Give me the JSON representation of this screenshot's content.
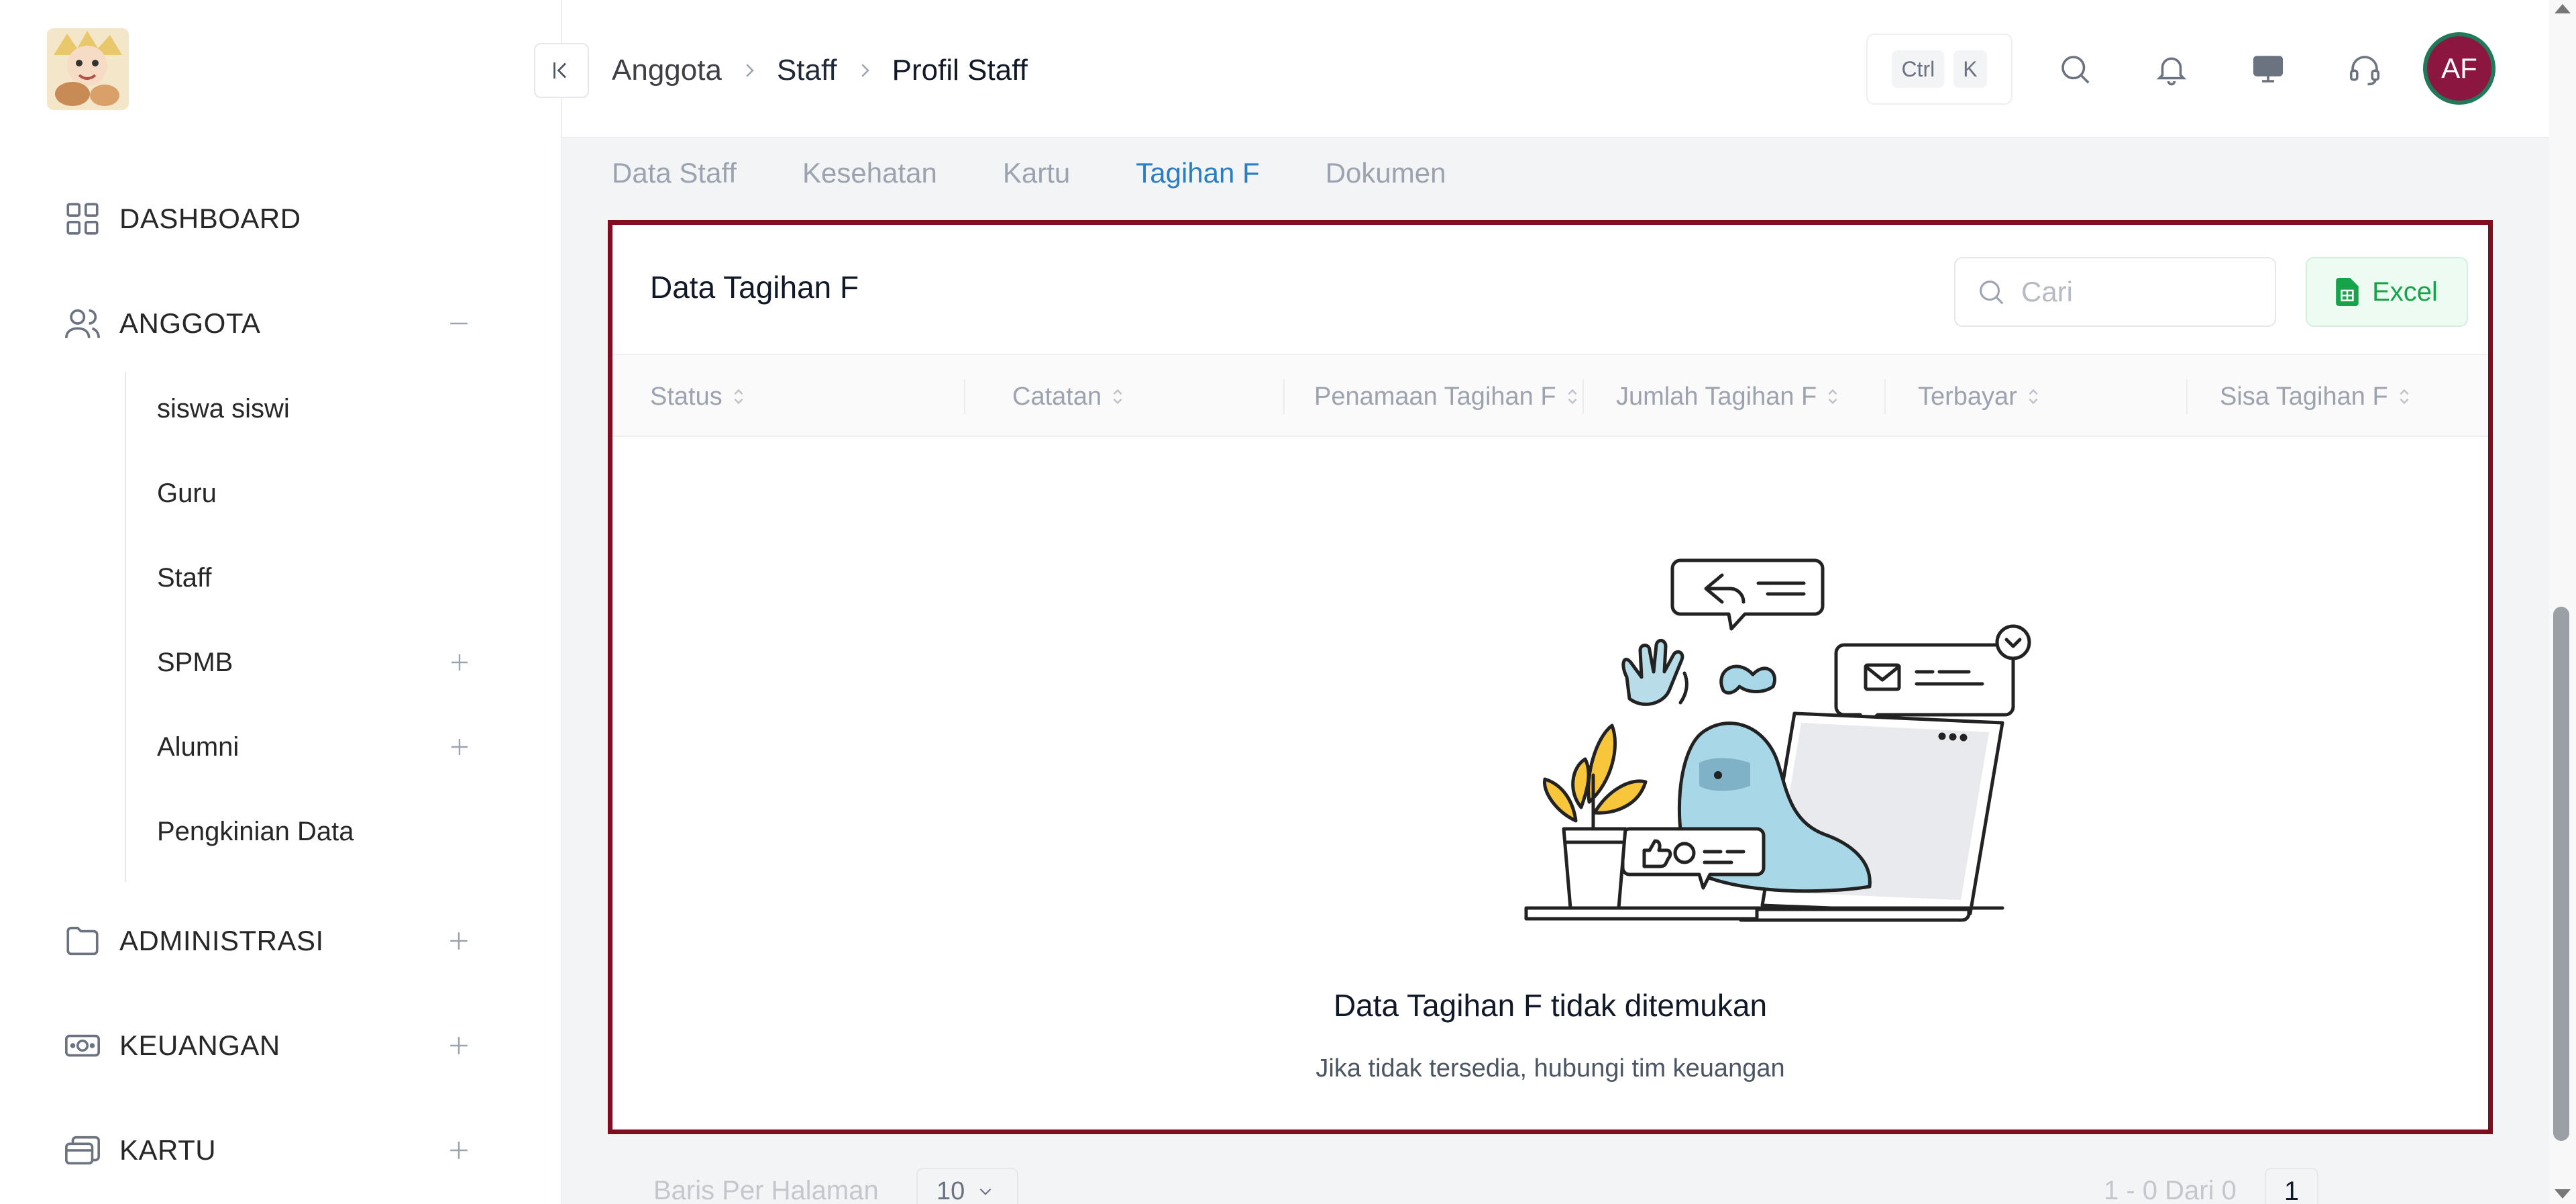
{
  "sidebar": {
    "items": [
      {
        "label": "DASHBOARD"
      },
      {
        "label": "ANGGOTA"
      },
      {
        "label": "ADMINISTRASI"
      },
      {
        "label": "KEUANGAN"
      },
      {
        "label": "KARTU"
      }
    ],
    "anggota_sub": [
      {
        "label": "siswa siswi"
      },
      {
        "label": "Guru"
      },
      {
        "label": "Staff"
      },
      {
        "label": "SPMB"
      },
      {
        "label": "Alumni"
      },
      {
        "label": "Pengkinian Data"
      }
    ]
  },
  "header": {
    "breadcrumb": [
      "Anggota",
      "Staff",
      "Profil Staff"
    ],
    "shortcut": [
      "Ctrl",
      "K"
    ],
    "avatar_initials": "AF",
    "avatar_color": "#8b1740"
  },
  "tabs": [
    {
      "label": "Data Staff"
    },
    {
      "label": "Kesehatan"
    },
    {
      "label": "Kartu"
    },
    {
      "label": "Tagihan F",
      "active": true
    },
    {
      "label": "Dokumen"
    }
  ],
  "card": {
    "title": "Data Tagihan F",
    "search_placeholder": "Cari",
    "excel_label": "Excel",
    "columns": [
      "Status",
      "Catatan",
      "Penamaan Tagihan F",
      "Jumlah Tagihan F",
      "Terbayar",
      "Sisa Tagihan F"
    ],
    "empty_title": "Data Tagihan F tidak ditemukan",
    "empty_subtitle": "Jika tidak tersedia, hubungi tim keuangan",
    "border_color": "#7f0f1f"
  },
  "footer": {
    "rows_label": "Baris Per Halaman",
    "rows_value": "10",
    "range": "1 - 0 Dari 0",
    "page": "1"
  }
}
